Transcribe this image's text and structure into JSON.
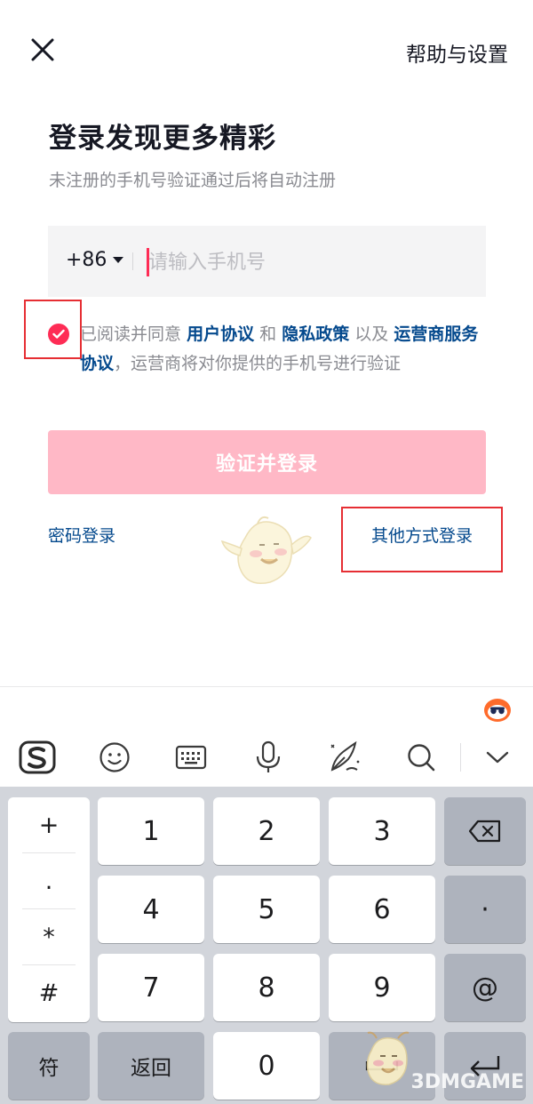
{
  "header": {
    "close_icon": "close-icon",
    "help_label": "帮助与设置"
  },
  "title": "登录发现更多精彩",
  "subtitle": "未注册的手机号验证通过后将自动注册",
  "phone": {
    "country_code": "+86",
    "placeholder": "请输入手机号",
    "value": ""
  },
  "agreement": {
    "checked": true,
    "prefix": "已阅读并同意",
    "user_agreement": "用户协议",
    "and": "和",
    "privacy_policy": "隐私政策",
    "also": "以及",
    "carrier_agreement": "运营商服务协议",
    "suffix": "，运营商将对你提供的手机号进行验证"
  },
  "login_button": "验证并登录",
  "password_login": "密码登录",
  "other_login": "其他方式登录",
  "colors": {
    "accent": "#fe2c55",
    "link": "#04498d",
    "button_disabled": "#ffb8c6",
    "highlight_box": "#e62e33"
  },
  "keyboard": {
    "toolbar_icons": [
      "sogou-logo-icon",
      "emoji-icon",
      "keyboard-icon",
      "microphone-icon",
      "handwriting-icon",
      "search-icon",
      "collapse-icon"
    ],
    "symbols": [
      "+",
      ".",
      "*",
      "#"
    ],
    "digits": [
      "1",
      "2",
      "3",
      "4",
      "5",
      "6",
      "7",
      "8",
      "9",
      "0"
    ],
    "right_keys": [
      "backspace-icon",
      "·",
      "@",
      "enter-icon"
    ],
    "bottom_left": "符",
    "bottom_back": "返回",
    "space_icon": "space-icon"
  },
  "watermark": "3DMGAME"
}
